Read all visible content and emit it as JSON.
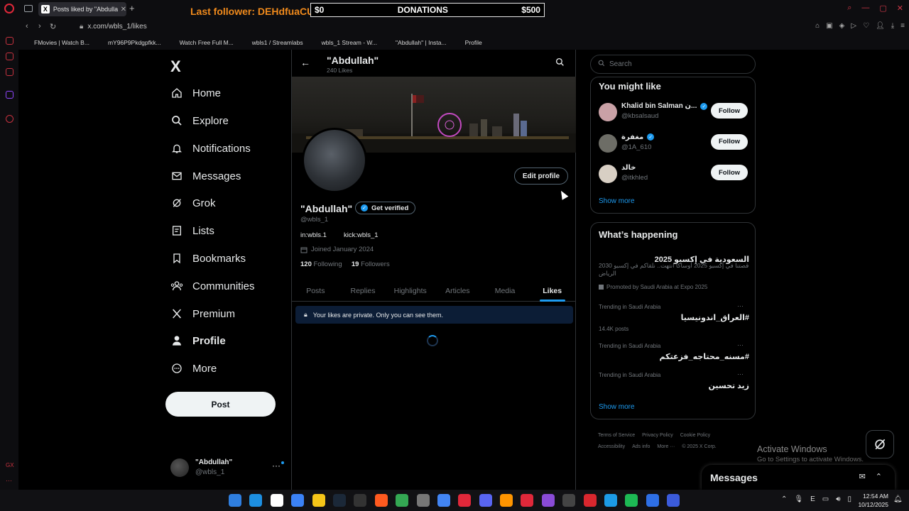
{
  "browser": {
    "tab_title": "Posts liked by \"Abdullah\"",
    "tab_favicon": "X",
    "url": "x.com/wbls_1/likes",
    "bookmarks": [
      {
        "label": "FMovies | Watch B...",
        "color": "#2a7de1"
      },
      {
        "label": "mY96P9Pkdgpfkk...",
        "color": "#888888"
      },
      {
        "label": "Watch Free Full M...",
        "color": "#3bb54a"
      },
      {
        "label": "wbls1 / Streamlabs",
        "color": "#80f5d2"
      },
      {
        "label": "wbls_1 Stream - W...",
        "color": "#53fc18"
      },
      {
        "label": "\"Abdullah\" | Insta...",
        "color": "#d63b7a"
      },
      {
        "label": "Profile",
        "color": "#c9303f"
      }
    ]
  },
  "overlay": {
    "last_follower": "Last follower: DEHdfuaCU",
    "donation_left": "$0",
    "donation_label": "DONATIONS",
    "donation_right": "$500"
  },
  "nav": {
    "logo": "X",
    "items": [
      {
        "label": "Home",
        "icon": "home-icon"
      },
      {
        "label": "Explore",
        "icon": "search-icon"
      },
      {
        "label": "Notifications",
        "icon": "bell-icon"
      },
      {
        "label": "Messages",
        "icon": "mail-icon"
      },
      {
        "label": "Grok",
        "icon": "grok-icon"
      },
      {
        "label": "Lists",
        "icon": "list-icon"
      },
      {
        "label": "Bookmarks",
        "icon": "bookmark-icon"
      },
      {
        "label": "Communities",
        "icon": "communities-icon"
      },
      {
        "label": "Premium",
        "icon": "x-icon"
      },
      {
        "label": "Profile",
        "icon": "person-icon"
      },
      {
        "label": "More",
        "icon": "more-circle-icon"
      }
    ],
    "post_label": "Post",
    "account_name": "\"Abdullah\"",
    "account_handle": "@wbls_1"
  },
  "profile": {
    "header_name": "\"Abdullah\"",
    "header_likes": "240 Likes",
    "name": "\"Abdullah\"",
    "get_verified": "Get verified",
    "handle": "@wbls_1",
    "bio_1": "in:wbls.1",
    "bio_2": "kick:wbls_1",
    "joined": "Joined January 2024",
    "following_count": "120",
    "following_label": "Following",
    "followers_count": "19",
    "followers_label": "Followers",
    "edit_profile": "Edit profile",
    "tabs": [
      "Posts",
      "Replies",
      "Highlights",
      "Articles",
      "Media",
      "Likes"
    ],
    "active_tab": "Likes",
    "private_note": "Your likes are private. Only you can see them."
  },
  "right": {
    "search_placeholder": "Search",
    "you_might_like": "You might like",
    "suggestions": [
      {
        "name": "Khalid bin Salman ن...",
        "handle": "@kbsalsaud",
        "verified": true,
        "follow": "Follow",
        "avatar_color": "#c9a1a6"
      },
      {
        "name": "مغفرة",
        "handle": "@1A_610",
        "verified": true,
        "follow": "Follow",
        "avatar_color": "#6d6d66"
      },
      {
        "name": "خالد",
        "handle": "@itkhled",
        "verified": false,
        "follow": "Follow",
        "avatar_color": "#d8cfc4"
      }
    ],
    "show_more": "Show more",
    "whats_happening": "What’s happening",
    "promo_title": "السعودية في إكسبو 2025",
    "promo_desc": "قصتنا في إكسبو 2025 أوساكا انتهت.. نلقاكم في إكسبو 2030 الرياض",
    "promo_by": "Promoted by Saudi Arabia at Expo 2025",
    "trends": [
      {
        "meta": "Trending in Saudi Arabia",
        "title": "#العراق_اندونيسيا",
        "posts": "14.4K posts"
      },
      {
        "meta": "Trending in Saudi Arabia",
        "title": "#مسنه_محتاجه_فزعتكم",
        "posts": ""
      },
      {
        "meta": "Trending in Saudi Arabia",
        "title": "زيد تحسين",
        "posts": ""
      }
    ],
    "footer": [
      "Terms of Service",
      "Privacy Policy",
      "Cookie Policy",
      "Accessibility",
      "Ads info",
      "More ···",
      "© 2025 X Corp."
    ]
  },
  "messages_drawer": {
    "title": "Messages"
  },
  "windows": {
    "activate_title": "Activate Windows",
    "activate_sub": "Go to Settings to activate Windows.",
    "time": "12:54 AM",
    "date": "10/12/2025"
  }
}
